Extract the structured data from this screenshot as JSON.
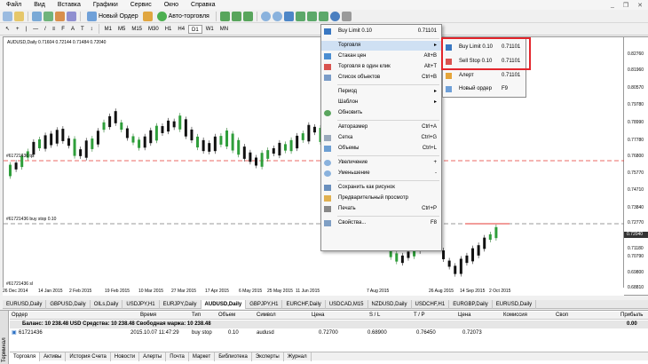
{
  "menubar": [
    "Файл",
    "Вид",
    "Вставка",
    "Графики",
    "Сервис",
    "Окно",
    "Справка"
  ],
  "toolbar": {
    "new_order": "Новый Ордер",
    "autotrading": "Авто-торговля"
  },
  "timeframes": [
    "M1",
    "M5",
    "M15",
    "M30",
    "H1",
    "H4",
    "D1",
    "W1",
    "MN"
  ],
  "chart": {
    "title": "AUDUSD,Daily  0.71604 0.72144 0.71484 0.72040",
    "labels": [
      "#61721436 tp",
      "#61721436 buy stop 0.10",
      "#61721436 sl"
    ],
    "price_ticks": [
      "0.82760",
      "0.81960",
      "0.80570",
      "0.79780",
      "0.78990",
      "0.77780",
      "0.76800",
      "0.75770",
      "0.74710",
      "0.73840",
      "0.72770",
      "0.72040",
      "0.71180",
      "0.70790",
      "0.69800",
      "0.68810"
    ],
    "current_price": "0.72040",
    "time_ticks": [
      "26 Dec 2014",
      "14 Jan 2015",
      "2 Feb 2015",
      "19 Feb 2015",
      "10 Mar 2015",
      "27 Mar 2015",
      "17 Apr 2015",
      "6 May 2015",
      "25 May 2015",
      "11 Jun 2015",
      "30 Jun 2015",
      "1 Jul 2015",
      "7 Aug 2015",
      "26 Aug 2015",
      "14 Sep 2015",
      "2 Oct 2015"
    ]
  },
  "context_menu": {
    "top": {
      "label": "Buy Limit 0.10",
      "value": "0.71101"
    },
    "items": [
      {
        "label": "Торговля",
        "sc": "",
        "arrow": true
      },
      {
        "label": "Стакан цен",
        "sc": "Alt+B"
      },
      {
        "label": "Торговля в один клик",
        "sc": "Alt+T"
      },
      {
        "label": "Список объектов",
        "sc": "Ctrl+B"
      },
      {
        "label": "Период",
        "sc": "",
        "arrow": true
      },
      {
        "label": "Шаблон",
        "sc": "",
        "arrow": true
      },
      {
        "label": "Обновить",
        "sc": ""
      },
      {
        "label": "Авторазмер",
        "sc": "Ctrl+A"
      },
      {
        "label": "Сетка",
        "sc": "Ctrl+G"
      },
      {
        "label": "Объемы",
        "sc": "Ctrl+L"
      },
      {
        "label": "Увеличение",
        "sc": "+"
      },
      {
        "label": "Уменьшение",
        "sc": "-"
      },
      {
        "label": "Сохранить как рисунок",
        "sc": ""
      },
      {
        "label": "Предварительный просмотр",
        "sc": ""
      },
      {
        "label": "Печать",
        "sc": "Ctrl+P"
      },
      {
        "label": "Свойства...",
        "sc": "F8"
      }
    ]
  },
  "submenu": [
    {
      "label": "Buy Limit 0.10",
      "value": "0.71101"
    },
    {
      "label": "Sell Stop 0.10",
      "value": "0.71101"
    },
    {
      "label": "Алерт",
      "value": "0.71101"
    },
    {
      "label": "Новый ордер",
      "value": "F9"
    }
  ],
  "symbol_tabs": [
    "EURUSD,Daily",
    "GBPUSD,Daily",
    "OILs,Daily",
    "USDJPY,H1",
    "EURJPY,Daily",
    "AUDUSD,Daily",
    "GBPJPY,H1",
    "EURCHF,Daily",
    "USDCAD,M15",
    "NZDUSD,Daily",
    "USDCHF,H1",
    "EURGBP,Daily",
    "EURUSD,Daily"
  ],
  "terminal": {
    "headers": [
      "Ордер",
      "Время",
      "Тип",
      "Объем",
      "Символ",
      "Цена",
      "S / L",
      "T / P",
      "Цена",
      "Комиссия",
      "Своп",
      "Прибыль"
    ],
    "balance": "Баланс: 10 238.48 USD  Средства: 10 238.48  Свободная маржа: 10 238.48",
    "balance_profit": "0.00",
    "order": {
      "id": "61721436",
      "time": "2015.10.07 11:47:29",
      "type": "buy stop",
      "volume": "0.10",
      "symbol": "audusd",
      "price": "0.72700",
      "sl": "0.68900",
      "tp": "0.76450",
      "cur": "0.72073"
    },
    "side_label": "Терминал",
    "tabs": [
      "Торговля",
      "Активы",
      "История Счета",
      "Новости",
      "Алерты",
      "Почта",
      "Маркет",
      "Библиотека",
      "Эксперты",
      "Журнал"
    ]
  }
}
